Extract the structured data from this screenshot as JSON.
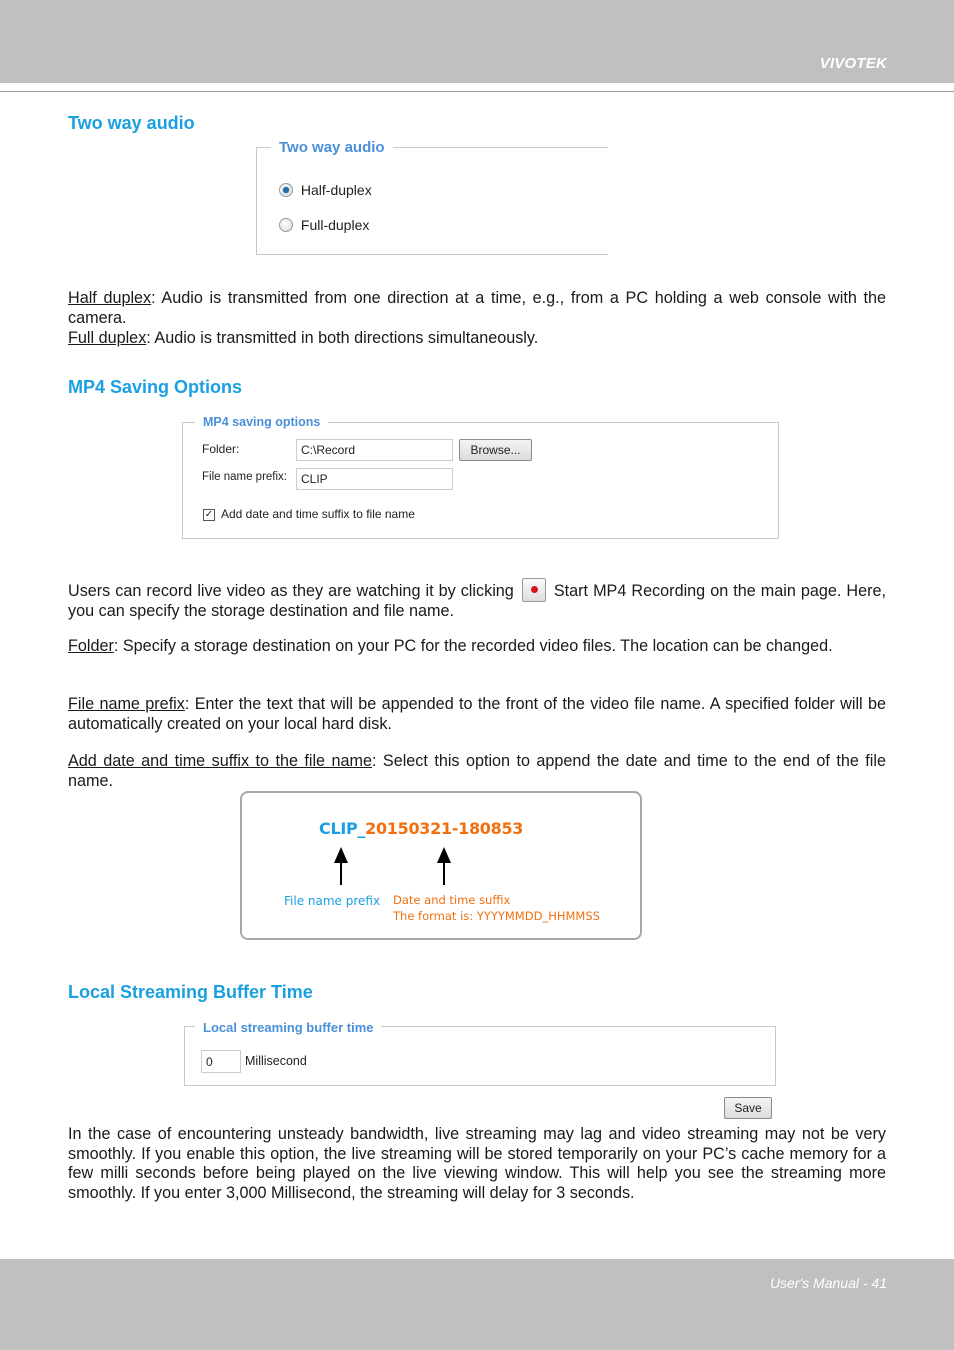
{
  "header": {
    "brand": "VIVOTEK"
  },
  "footer": {
    "page_label": "User's Manual - 41"
  },
  "sections": {
    "two_way_audio": {
      "heading": "Two way audio",
      "panel": {
        "legend": "Two way audio",
        "options": [
          {
            "label": "Half-duplex",
            "selected": true
          },
          {
            "label": "Full-duplex",
            "selected": false
          }
        ]
      },
      "desc": [
        {
          "term": "Half duplex",
          "text": ": Audio is transmitted from one direction at a time, e.g., from a PC holding a web console with the camera."
        },
        {
          "term": "Full duplex",
          "text": ": Audio is transmitted in both directions simultaneously."
        }
      ]
    },
    "mp4": {
      "heading": "MP4 Saving Options",
      "panel": {
        "legend": "MP4 saving options",
        "folder_label": "Folder:",
        "folder_value": "C:\\Record",
        "browse_label": "Browse...",
        "prefix_label": "File name prefix:",
        "prefix_value": "CLIP",
        "suffix_checkbox_label": "Add date and time suffix to file name",
        "suffix_checked": true
      },
      "intro_before": "Users can record live video as they are watching it by clicking",
      "intro_after": "Start MP4 Recording on the main page. Here, you can specify the storage destination and file name.",
      "record_icon": "record-icon",
      "desc": [
        {
          "term": "Folder",
          "text": ": Specify a storage destination on your PC for the recorded video files. The location can be changed."
        },
        {
          "term": "File name prefix",
          "text": ": Enter the text that will be appended to the front of the video file name. A specified folder will be automatically created on your local hard disk."
        },
        {
          "term": "Add date and time suffix to the file name",
          "text": ": Select this option to append the date and time to the end of the file name."
        }
      ],
      "diagram": {
        "filename_prefix": "CLIP_",
        "filename_suffix": "20150321-180853",
        "prefix_caption": "File name prefix",
        "suffix_caption": "Date and time suffix",
        "format_caption": "The format is: YYYYMMDD_HHMMSS",
        "colors": {
          "prefix": "#1aa0e0",
          "suffix": "#f07010"
        }
      }
    },
    "buffer": {
      "heading": "Local Streaming Buffer Time",
      "panel": {
        "legend": "Local streaming buffer time",
        "value": "0",
        "unit": "Millisecond"
      },
      "save_label": "Save",
      "desc": "In the case of encountering unsteady bandwidth, live streaming may lag and video streaming may not be very smoothly. If you enable this option, the live streaming will be stored temporarily on your PC’s cache memory for a few milli seconds before being played on the live viewing window. This will help you see the streaming more smoothly. If you enter 3,000 Millisecond, the streaming will delay for 3 seconds."
    }
  },
  "colors": {
    "heading": "#1aa0e0",
    "legend": "#4a90d9",
    "band": "#bfc1c0"
  }
}
